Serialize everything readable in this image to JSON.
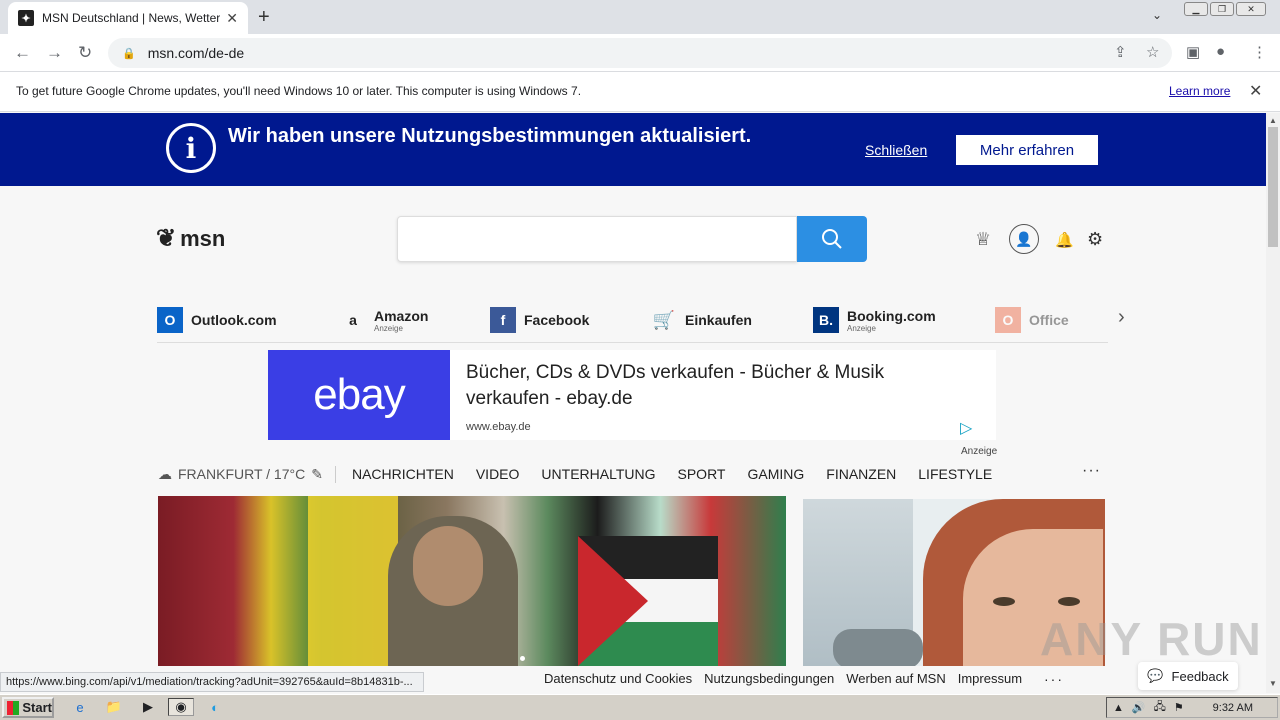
{
  "browser": {
    "tab_title": "MSN Deutschland | News, Wetter, Sport",
    "tab_favicon": "msn-favicon-icon",
    "new_tab_glyph": "+",
    "url": "msn.com/de-de",
    "infobar_message": "To get future Google Chrome updates, you'll need Windows 10 or later. This computer is using Windows 7.",
    "infobar_link": "Learn more"
  },
  "banner": {
    "text": "Wir haben unsere Nutzungsbestimmungen aktualisiert.",
    "close_label": "Schließen",
    "more_label": "Mehr erfahren",
    "color": "#00188f"
  },
  "header": {
    "logo_text": "msn",
    "search_button_color": "#2c8fe3"
  },
  "quicklinks": [
    {
      "label": "Outlook.com",
      "sub": "",
      "icon": "outlook-icon",
      "color": "#0a64c8"
    },
    {
      "label": "Amazon",
      "sub": "Anzeige",
      "icon": "amazon-icon",
      "color": "#222222"
    },
    {
      "label": "Facebook",
      "sub": "",
      "icon": "facebook-icon",
      "color": "#3b5998"
    },
    {
      "label": "Einkaufen",
      "sub": "",
      "icon": "shopping-cart-icon",
      "color": "#1a6fe0"
    },
    {
      "label": "Booking.com",
      "sub": "Anzeige",
      "icon": "booking-icon",
      "color": "#003580"
    },
    {
      "label": "Office",
      "sub": "",
      "icon": "office-icon",
      "color": "#eb5f3a"
    }
  ],
  "ad": {
    "brand": "ebay",
    "headline": "Bücher, CDs & DVDs verkaufen - Bücher & Musik verkaufen - ebay.de",
    "url": "www.ebay.de",
    "label": "Anzeige"
  },
  "nav": {
    "weather": "FRANKFURT / 17°C",
    "links": [
      "NACHRICHTEN",
      "VIDEO",
      "UNTERHALTUNG",
      "SPORT",
      "GAMING",
      "FINANZEN",
      "LIFESTYLE"
    ],
    "more": "···"
  },
  "status_url": "https://www.bing.com/api/v1/mediation/tracking?adUnit=392765&auId=8b14831b-...",
  "footer": {
    "links": [
      "Datenschutz und Cookies",
      "Nutzungsbedingungen",
      "Werben auf MSN",
      "Impressum"
    ],
    "more": "···",
    "feedback": "Feedback"
  },
  "watermark": "ANY RUN",
  "taskbar": {
    "start_label": "Start",
    "clock": "9:32 AM"
  }
}
